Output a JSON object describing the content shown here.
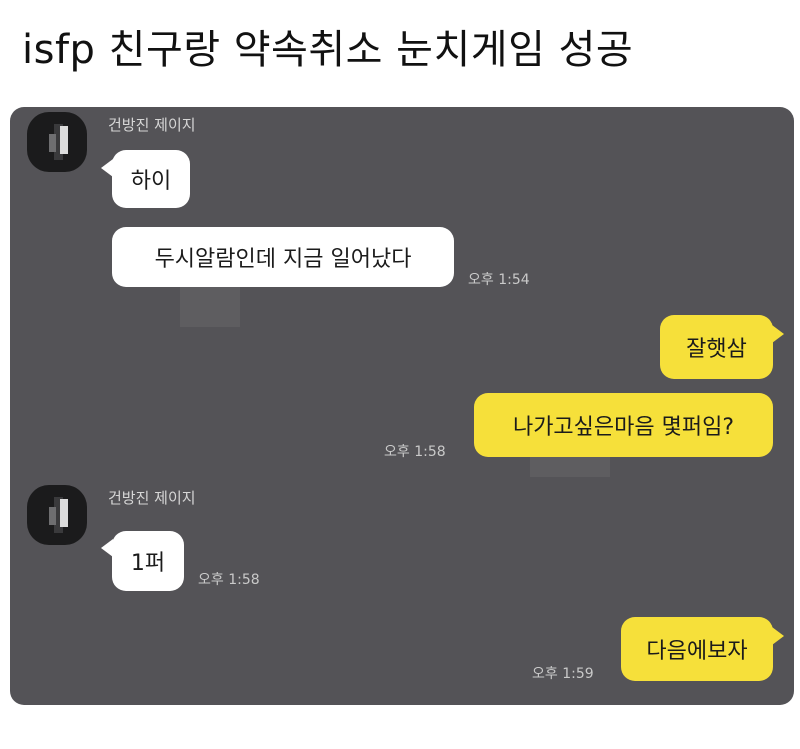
{
  "post": {
    "title": "isfp 친구랑 약속취소 눈치게임 성공"
  },
  "chat": {
    "messages": [
      {
        "sender": "건방진 제이지",
        "text": "하이"
      },
      {
        "text": "두시알람인데 지금 일어났다",
        "time": "오후 1:54"
      },
      {
        "text": "잘햇삼"
      },
      {
        "text": "나가고싶은마음 몇퍼임?",
        "time": "오후 1:58"
      },
      {
        "sender": "건방진 제이지",
        "text": "1퍼",
        "time": "오후 1:58"
      },
      {
        "text": "다음에보자",
        "time": "오후 1:59"
      }
    ]
  },
  "colors": {
    "chat_background": "#545357",
    "incoming_bubble": "#ffffff",
    "outgoing_bubble": "#f6e03a"
  }
}
